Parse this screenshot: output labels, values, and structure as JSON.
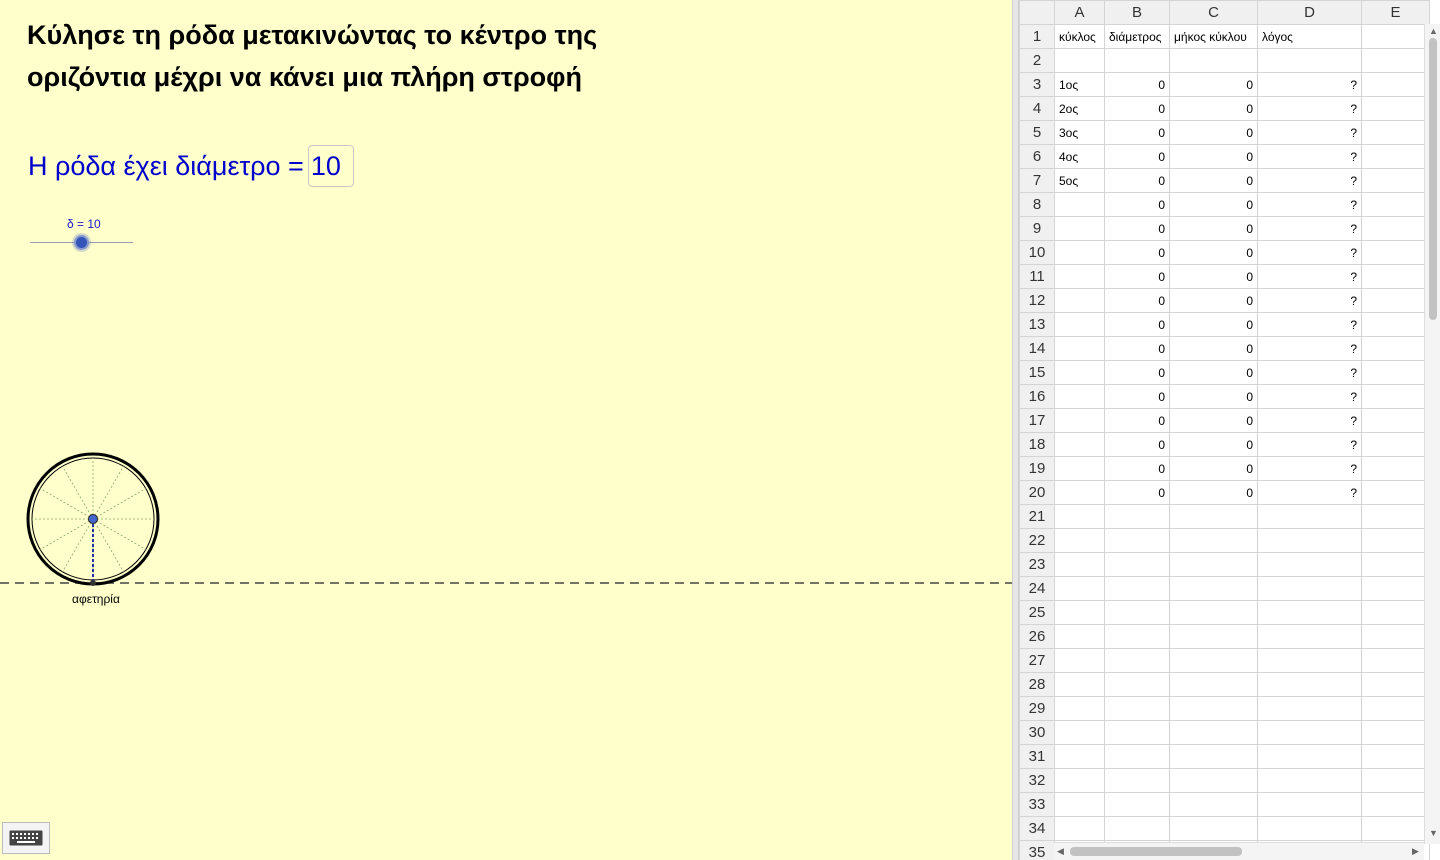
{
  "instruction": {
    "line1": "Κύλησε τη ρόδα μετακινώντας το κέντρο της",
    "line2": "οριζόντια μέχρι να κάνει μια πλήρη στροφή"
  },
  "diameter": {
    "label": "Η ρόδα έχει διάμετρο =",
    "value": "10"
  },
  "slider": {
    "label": "δ = 10",
    "fraction": 0.5
  },
  "start_label": "αφετηρία",
  "colors": {
    "background": "#ffffcc",
    "accent": "#0000cc",
    "slider": "#3355bb"
  },
  "keyboard_icon": "keyboard-icon",
  "spreadsheet": {
    "columns": [
      "A",
      "B",
      "C",
      "D",
      "E"
    ],
    "rows": [
      {
        "n": "1",
        "cells": [
          "κύκλος",
          "διάμετρος",
          "μήκος κύκλου",
          "λόγος",
          ""
        ]
      },
      {
        "n": "2",
        "cells": [
          "",
          "",
          "",
          "",
          ""
        ]
      },
      {
        "n": "3",
        "cells": [
          "1ος",
          "0",
          "0",
          "?",
          ""
        ]
      },
      {
        "n": "4",
        "cells": [
          "2ος",
          "0",
          "0",
          "?",
          ""
        ]
      },
      {
        "n": "5",
        "cells": [
          "3ος",
          "0",
          "0",
          "?",
          ""
        ]
      },
      {
        "n": "6",
        "cells": [
          "4ος",
          "0",
          "0",
          "?",
          ""
        ]
      },
      {
        "n": "7",
        "cells": [
          "5ος",
          "0",
          "0",
          "?",
          ""
        ]
      },
      {
        "n": "8",
        "cells": [
          "",
          "0",
          "0",
          "?",
          ""
        ]
      },
      {
        "n": "9",
        "cells": [
          "",
          "0",
          "0",
          "?",
          ""
        ]
      },
      {
        "n": "10",
        "cells": [
          "",
          "0",
          "0",
          "?",
          ""
        ]
      },
      {
        "n": "11",
        "cells": [
          "",
          "0",
          "0",
          "?",
          ""
        ]
      },
      {
        "n": "12",
        "cells": [
          "",
          "0",
          "0",
          "?",
          ""
        ]
      },
      {
        "n": "13",
        "cells": [
          "",
          "0",
          "0",
          "?",
          ""
        ]
      },
      {
        "n": "14",
        "cells": [
          "",
          "0",
          "0",
          "?",
          ""
        ]
      },
      {
        "n": "15",
        "cells": [
          "",
          "0",
          "0",
          "?",
          ""
        ]
      },
      {
        "n": "16",
        "cells": [
          "",
          "0",
          "0",
          "?",
          ""
        ]
      },
      {
        "n": "17",
        "cells": [
          "",
          "0",
          "0",
          "?",
          ""
        ]
      },
      {
        "n": "18",
        "cells": [
          "",
          "0",
          "0",
          "?",
          ""
        ]
      },
      {
        "n": "19",
        "cells": [
          "",
          "0",
          "0",
          "?",
          ""
        ]
      },
      {
        "n": "20",
        "cells": [
          "",
          "0",
          "0",
          "?",
          ""
        ]
      },
      {
        "n": "21",
        "cells": [
          "",
          "",
          "",
          "",
          ""
        ]
      },
      {
        "n": "22",
        "cells": [
          "",
          "",
          "",
          "",
          ""
        ]
      },
      {
        "n": "23",
        "cells": [
          "",
          "",
          "",
          "",
          ""
        ]
      },
      {
        "n": "24",
        "cells": [
          "",
          "",
          "",
          "",
          ""
        ]
      },
      {
        "n": "25",
        "cells": [
          "",
          "",
          "",
          "",
          ""
        ]
      },
      {
        "n": "26",
        "cells": [
          "",
          "",
          "",
          "",
          ""
        ]
      },
      {
        "n": "27",
        "cells": [
          "",
          "",
          "",
          "",
          ""
        ]
      },
      {
        "n": "28",
        "cells": [
          "",
          "",
          "",
          "",
          ""
        ]
      },
      {
        "n": "29",
        "cells": [
          "",
          "",
          "",
          "",
          ""
        ]
      },
      {
        "n": "30",
        "cells": [
          "",
          "",
          "",
          "",
          ""
        ]
      },
      {
        "n": "31",
        "cells": [
          "",
          "",
          "",
          "",
          ""
        ]
      },
      {
        "n": "32",
        "cells": [
          "",
          "",
          "",
          "",
          ""
        ]
      },
      {
        "n": "33",
        "cells": [
          "",
          "",
          "",
          "",
          ""
        ]
      },
      {
        "n": "34",
        "cells": [
          "",
          "",
          "",
          "",
          ""
        ]
      },
      {
        "n": "35",
        "cells": [
          "",
          "",
          "",
          "",
          ""
        ]
      }
    ]
  }
}
